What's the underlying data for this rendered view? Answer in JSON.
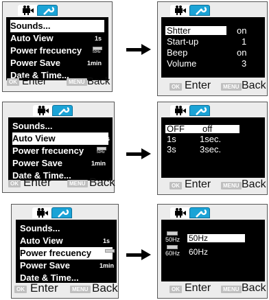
{
  "menu_items": [
    "Sounds...",
    "Auto View",
    "Power frecuency",
    "Power Save",
    "Date & Time..."
  ],
  "menu_values": {
    "auto_view": "1s",
    "power_frecuency": "50Hz",
    "power_save": "1min"
  },
  "footer": {
    "ok_key": "OK",
    "enter": "Enter",
    "menu_key": "MENU",
    "back": "Back"
  },
  "sounds_submenu": [
    {
      "label": "Shtter",
      "value": "on"
    },
    {
      "label": "Start-up",
      "value": "1"
    },
    {
      "label": "Beep",
      "value": "on"
    },
    {
      "label": "Volume",
      "value": "3"
    }
  ],
  "auto_view_submenu": [
    {
      "label": "OFF",
      "value": "off"
    },
    {
      "label": "1s",
      "value": "1sec."
    },
    {
      "label": "3s",
      "value": "3sec."
    }
  ],
  "frequency_submenu": [
    {
      "icon_text": "50Hz",
      "label": "50Hz"
    },
    {
      "icon_text": "60Hz",
      "label": "60Hz"
    }
  ],
  "colors": {
    "accent_tab": "#1ba3d6",
    "screen": "#000000",
    "highlight": "#ffffff",
    "panel": "#ececec"
  },
  "icons": [
    "video-camera-icon",
    "wrench-icon",
    "right-arrow-icon",
    "frequency-icon"
  ]
}
